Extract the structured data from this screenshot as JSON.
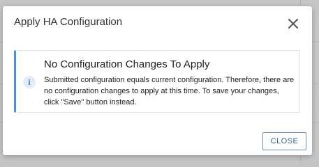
{
  "dialog": {
    "title": "Apply HA Configuration",
    "close_icon": "close-icon",
    "alert": {
      "icon": "info-icon",
      "icon_glyph": "i",
      "title": "No Configuration Changes To Apply",
      "message": "Submitted configuration equals current configuration. Therefore, there are no configuration changes to apply at this time. To save your changes, click \"Save\" button instead."
    },
    "close_button_label": "CLOSE"
  },
  "colors": {
    "accent": "#4a90d9",
    "button_text": "#2f5f91",
    "backdrop": "#c6c6c6"
  }
}
